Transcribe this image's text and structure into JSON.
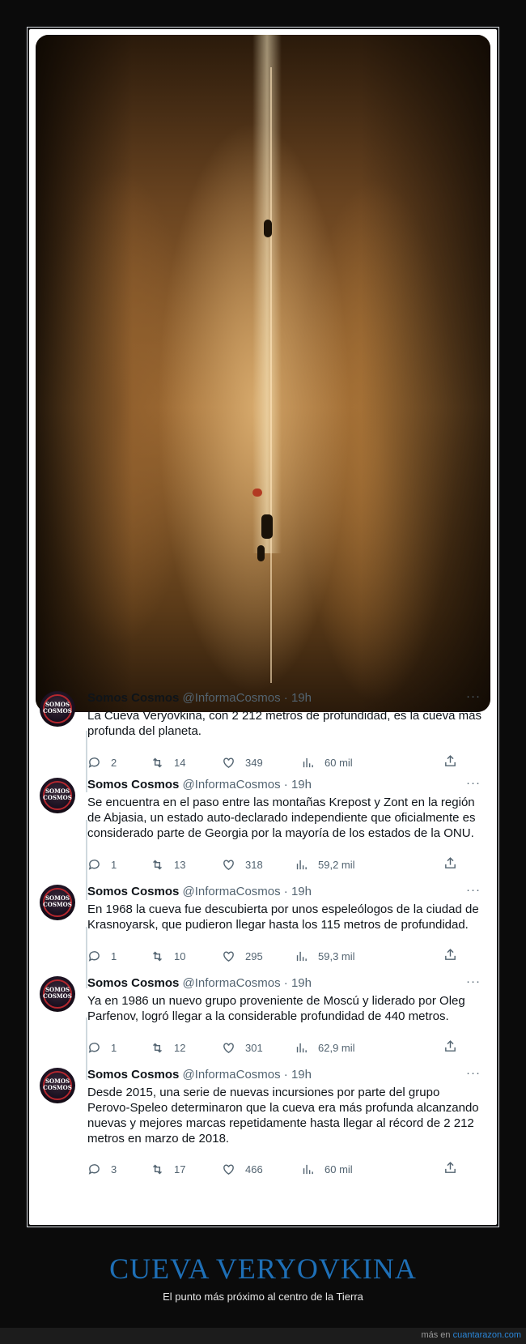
{
  "author": {
    "name": "Somos Cosmos",
    "handle": "@InformaCosmos",
    "time": "· 19h",
    "avatar_text_1": "SOMOS",
    "avatar_text_2": "COSMOS"
  },
  "more_label": "···",
  "tweets": [
    {
      "text": "La Cueva Veryovkina, con 2 212 metros de profundidad, es la cueva más profunda del planeta.",
      "replies": "2",
      "retweets": "14",
      "likes": "349",
      "views": "60 mil"
    },
    {
      "text": "Se encuentra en el paso entre las montañas Krepost y Zont en la región de Abjasia, un estado auto-declarado independiente que oficialmente es considerado parte de Georgia por la mayoría de los estados de la ONU.",
      "replies": "1",
      "retweets": "13",
      "likes": "318",
      "views": "59,2 mil"
    },
    {
      "text": "En 1968 la cueva fue descubierta por unos espeleólogos de la ciudad de Krasnoyarsk, que pudieron llegar hasta los 115 metros de profundidad.",
      "replies": "1",
      "retweets": "10",
      "likes": "295",
      "views": "59,3 mil"
    },
    {
      "text": "Ya en 1986 un nuevo grupo proveniente de Moscú y liderado por Oleg Parfenov, logró llegar a la considerable profundidad de 440 metros.",
      "replies": "1",
      "retweets": "12",
      "likes": "301",
      "views": "62,9 mil"
    },
    {
      "text": "Desde 2015, una serie de nuevas incursiones por parte del grupo Perovo-Speleo determinaron que la cueva era más profunda alcanzando nuevas y mejores marcas repetidamente hasta llegar al récord de 2 212 metros en marzo de 2018.",
      "replies": "3",
      "retweets": "17",
      "likes": "466",
      "views": "60 mil"
    }
  ],
  "footer": {
    "title": "CUEVA VERYOVKINA",
    "subtitle": "El punto más próximo al centro de la Tierra",
    "credit_prefix": "más en",
    "credit_site": "cuantarazon.com"
  },
  "colors": {
    "accent": "#1e6fb6",
    "link": "#2a86d8",
    "text": "#0f1419",
    "muted": "#536471"
  }
}
